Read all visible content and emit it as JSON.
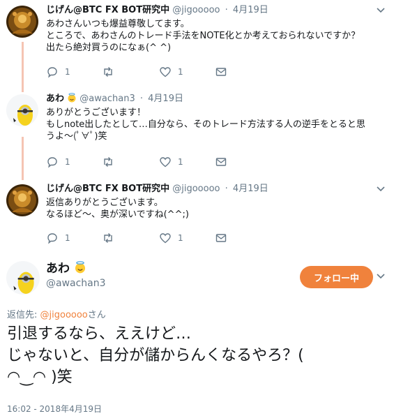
{
  "tweets": [
    {
      "name": "じげん@BTC FX BOT研究中",
      "handle": "@jigooooo",
      "date": "4月19日",
      "lines": [
        "あわさんいつも爆益尊敬してます。",
        "ところで、あわさんのトレード手法をNOTE化とか考えておられないですか？",
        "出たら絶対買うのになぁ(^ ^)"
      ],
      "reply_count": "1",
      "retweet_count": "",
      "like_count": "1"
    },
    {
      "name": "あわ",
      "handle": "@awachan3",
      "date": "4月19日",
      "lines": [
        "ありがとうございます！",
        "もしnote出したとして…自分なら、そのトレード方法する人の逆手をとると思",
        "うよ〜(ﾟ∀ﾟ)笑"
      ],
      "reply_count": "1",
      "retweet_count": "",
      "like_count": "1"
    },
    {
      "name": "じげん@BTC FX BOT研究中",
      "handle": "@jigooooo",
      "date": "4月19日",
      "lines": [
        "返信ありがとうございます。",
        "なるほど〜、奥が深いですね(^^;)"
      ],
      "reply_count": "1",
      "retweet_count": "",
      "like_count": "1"
    }
  ],
  "main": {
    "name": "あわ",
    "handle": "@awachan3",
    "follow_label": "フォロー中",
    "reply_prefix": "返信先: ",
    "reply_mention": "@jigooooo",
    "reply_suffix": "さん",
    "lines": [
      "引退するなら、ええけど…",
      "じゃないと、自分が儲からんくなるやろ？(",
      "◠‿◠ )笑"
    ],
    "timestamp": "16:02 - 2018年4月19日"
  },
  "colors": {
    "accent": "#f0823c",
    "muted": "#657786",
    "thread": "#f5c4b3"
  },
  "icons": [
    "reply-icon",
    "retweet-icon",
    "heart-icon",
    "mail-icon",
    "chevron-down-icon",
    "halo-smile-emoji"
  ]
}
